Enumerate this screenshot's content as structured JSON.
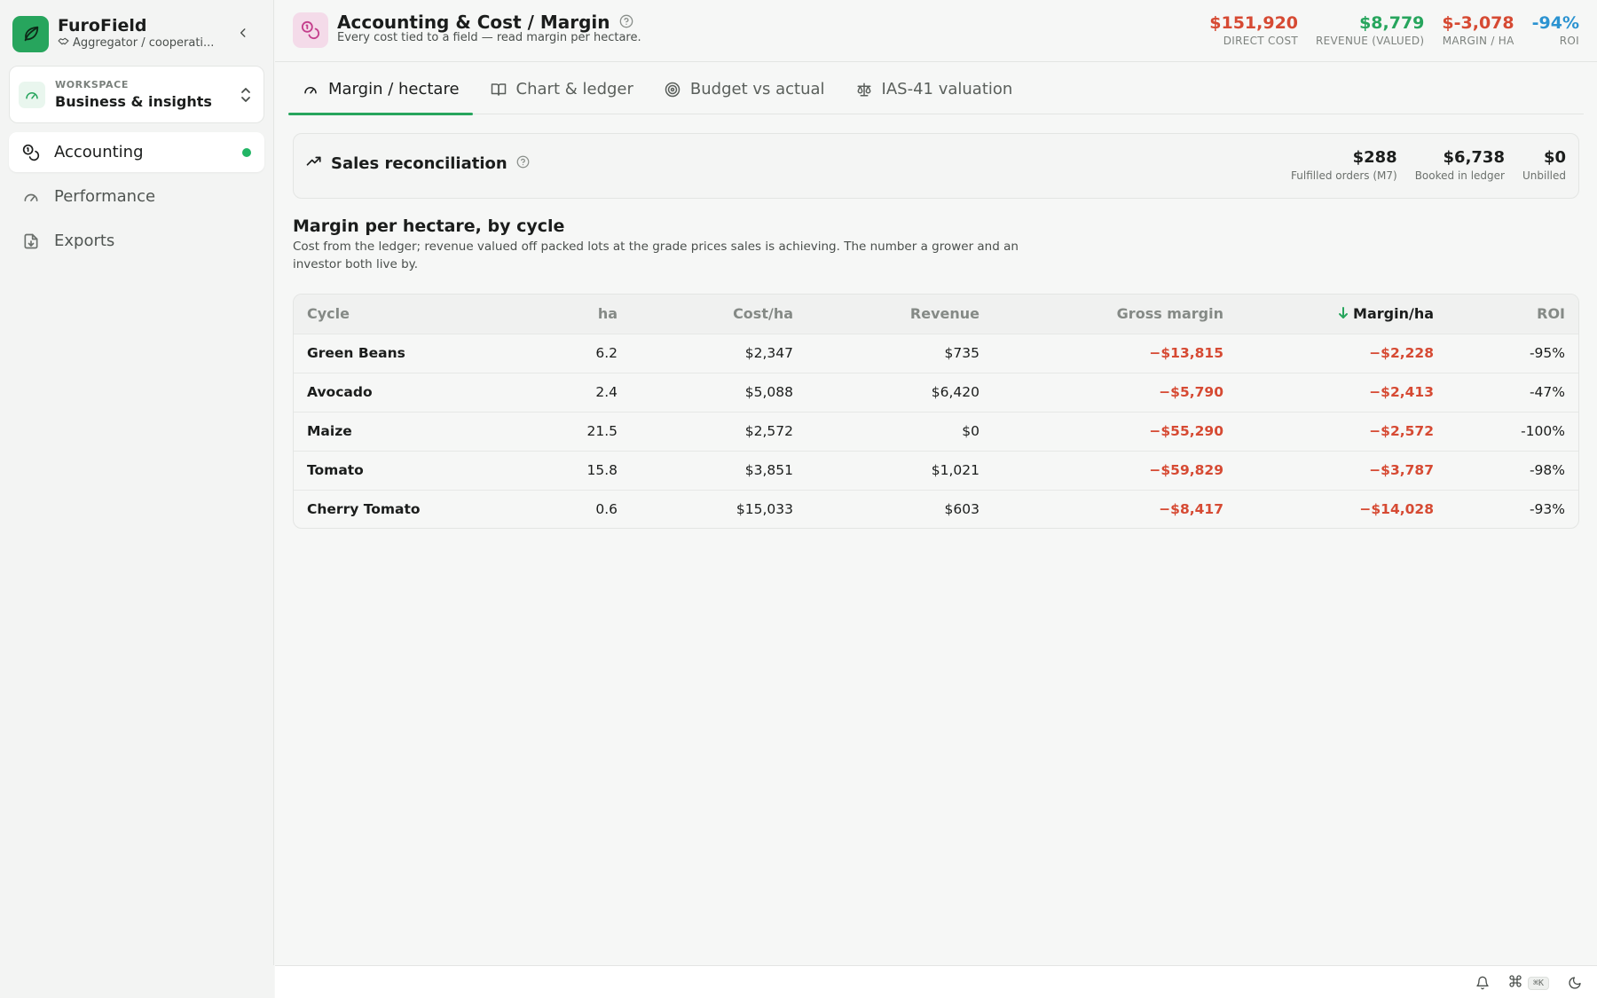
{
  "brand": {
    "name": "FuroField",
    "subtitle": "Aggregator / cooperati..."
  },
  "workspace": {
    "label": "WORKSPACE",
    "name": "Business & insights"
  },
  "nav": [
    {
      "label": "Accounting",
      "icon": "coins-icon",
      "active": true
    },
    {
      "label": "Performance",
      "icon": "gauge-icon"
    },
    {
      "label": "Exports",
      "icon": "file-download-icon"
    }
  ],
  "header": {
    "title": "Accounting & Cost / Margin",
    "subtitle": "Every cost tied to a field — read margin per hectare.",
    "kpis": [
      {
        "value": "$151,920",
        "label": "DIRECT COST",
        "color": "#d64a33"
      },
      {
        "value": "$8,779",
        "label": "REVENUE (VALUED)",
        "color": "#27a55d"
      },
      {
        "value": "$-3,078",
        "label": "MARGIN / HA",
        "color": "#d64a33"
      },
      {
        "value": "-94%",
        "label": "ROI",
        "color": "#2b93d1"
      }
    ]
  },
  "tabs": [
    {
      "label": "Margin / hectare",
      "icon": "gauge-icon",
      "active": true
    },
    {
      "label": "Chart & ledger",
      "icon": "book-icon"
    },
    {
      "label": "Budget vs actual",
      "icon": "target-icon"
    },
    {
      "label": "IAS-41 valuation",
      "icon": "scale-icon"
    }
  ],
  "reconciliation": {
    "title": "Sales reconciliation",
    "stats": [
      {
        "value": "$288",
        "label": "Fulfilled orders (M7)"
      },
      {
        "value": "$6,738",
        "label": "Booked in ledger"
      },
      {
        "value": "$0",
        "label": "Unbilled"
      }
    ]
  },
  "section": {
    "title": "Margin per hectare, by cycle",
    "description": "Cost from the ledger; revenue valued off packed lots at the grade prices sales is achieving. The number a grower and an investor both live by."
  },
  "table": {
    "columns": [
      "Cycle",
      "ha",
      "Cost/ha",
      "Revenue",
      "Gross margin",
      "Margin/ha",
      "ROI"
    ],
    "rows": [
      [
        "Green Beans",
        "6.2",
        "$2,347",
        "$735",
        "−$13,815",
        "−$2,228",
        "-95%"
      ],
      [
        "Avocado",
        "2.4",
        "$5,088",
        "$6,420",
        "−$5,790",
        "−$2,413",
        "-47%"
      ],
      [
        "Maize",
        "21.5",
        "$2,572",
        "$0",
        "−$55,290",
        "−$2,572",
        "-100%"
      ],
      [
        "Tomato",
        "15.8",
        "$3,851",
        "$1,021",
        "−$59,829",
        "−$3,787",
        "-98%"
      ],
      [
        "Cherry Tomato",
        "0.6",
        "$15,033",
        "$603",
        "−$8,417",
        "−$14,028",
        "-93%"
      ]
    ]
  },
  "footer": {
    "shortcut": "⌘K"
  }
}
